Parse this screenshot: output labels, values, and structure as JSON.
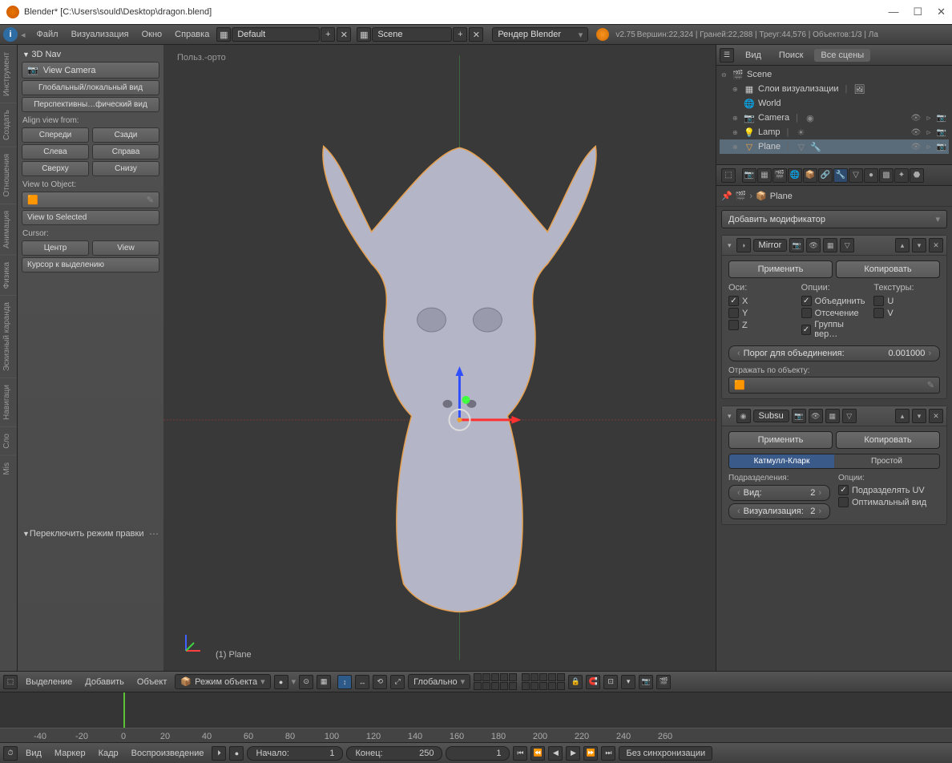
{
  "title": "Blender* [C:\\Users\\sould\\Desktop\\dragon.blend]",
  "menubar": {
    "file": "Файл",
    "render": "Визуализация",
    "window": "Окно",
    "help": "Справка",
    "layout": "Default",
    "scene": "Scene",
    "engine": "Рендер Blender",
    "version": "v2.75",
    "stats": "Вершин:22,324 | Граней:22,288 | Треуг:44,576 | Объектов:1/3 | Ла"
  },
  "left_tabs": [
    "Инструмент",
    "Создать",
    "Отношения",
    "Анимация",
    "Физика",
    "Эскизный карандa",
    "Навигаци",
    "Сло",
    "Mis"
  ],
  "tool_panel": {
    "header_3dnav": "3D Nav",
    "view_camera": "View Camera",
    "global_local": "Глобальный/локальный вид",
    "persp_ortho": "Перспективны…фический вид",
    "align_label": "Align view from:",
    "front": "Спереди",
    "back": "Сзади",
    "left": "Слева",
    "right": "Справа",
    "top": "Сверху",
    "bottom": "Снизу",
    "view_to_object": "View to Object:",
    "view_to_selected": "View to Selected",
    "cursor_label": "Cursor:",
    "center": "Центр",
    "view": "View",
    "cursor_to_sel": "Курсор к выделению",
    "edit_toggle": "Переключить режим правки"
  },
  "viewport": {
    "projection": "Польз.-орто",
    "object_label": "(1) Plane"
  },
  "outliner": {
    "view": "Вид",
    "search": "Поиск",
    "all_scenes": "Все сцены",
    "scene": "Scene",
    "render_layers": "Слои визуализации",
    "world": "World",
    "camera": "Camera",
    "lamp": "Lamp",
    "plane": "Plane"
  },
  "properties": {
    "breadcrumb_obj": "Plane",
    "add_modifier": "Добавить модификатор",
    "mod_mirror": {
      "name": "Mirror",
      "apply": "Применить",
      "copy": "Копировать",
      "axis_hdr": "Оси:",
      "options_hdr": "Опции:",
      "textures_hdr": "Текстуры:",
      "x": "X",
      "y": "Y",
      "z": "Z",
      "merge": "Объединить",
      "clip": "Отсечение",
      "vgroups": "Группы вер…",
      "u": "U",
      "v": "V",
      "merge_limit_label": "Порог для объединения:",
      "merge_limit_value": "0.001000",
      "mirror_object": "Отражать по объекту:"
    },
    "mod_subsurf": {
      "name": "Subsu",
      "apply": "Применить",
      "copy": "Копировать",
      "catmull": "Катмулл-Кларк",
      "simple": "Простой",
      "subdivisions": "Подразделения:",
      "options": "Опции:",
      "view_label": "Вид:",
      "view_val": "2",
      "render_label": "Визуализация:",
      "render_val": "2",
      "subdivide_uv": "Подразделять UV",
      "optimal": "Оптимальный вид"
    }
  },
  "view3d_header": {
    "select": "Выделение",
    "add": "Добавить",
    "object": "Объект",
    "mode": "Режим объекта",
    "orientation": "Глобально"
  },
  "timeline": {
    "ticks": [
      "-40",
      "-20",
      "0",
      "20",
      "40",
      "60",
      "80",
      "100",
      "120",
      "140",
      "160",
      "180",
      "200",
      "220",
      "240",
      "260"
    ],
    "view": "Вид",
    "marker": "Маркер",
    "frame": "Кадр",
    "playback": "Воспроизведение",
    "start_label": "Начало:",
    "start_val": "1",
    "end_label": "Конец:",
    "end_val": "250",
    "current": "1",
    "sync": "Без синхронизации"
  }
}
